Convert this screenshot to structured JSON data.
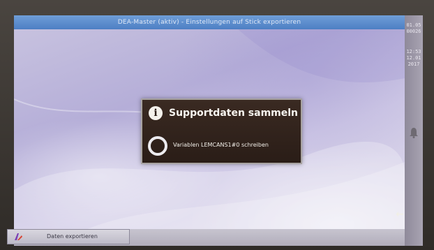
{
  "window": {
    "title": "DEA-Master (aktiv) - Einstellungen auf Stick exportieren"
  },
  "sidebar": {
    "time_lines": [
      "01.05",
      "00026",
      "12:53",
      "12.01",
      "2017"
    ]
  },
  "dialog": {
    "title": "Supportdaten sammeln",
    "info_glyph": "i",
    "status": "Variablen LEMCANS1#0 schreiben"
  },
  "taskbar": {
    "button_label": "Daten exportieren"
  },
  "icons": {
    "dialog": "info-icon",
    "progress": "progress-spinner",
    "sidebar_alarm": "bell-icon",
    "back": "arrow-left-icon",
    "task": "export-icon"
  },
  "colors": {
    "titlebar": "#4d7fc4",
    "dialog_bg": "#2f2019",
    "dialog_border": "#a7a2a0",
    "desktop": "#c3bde0"
  }
}
